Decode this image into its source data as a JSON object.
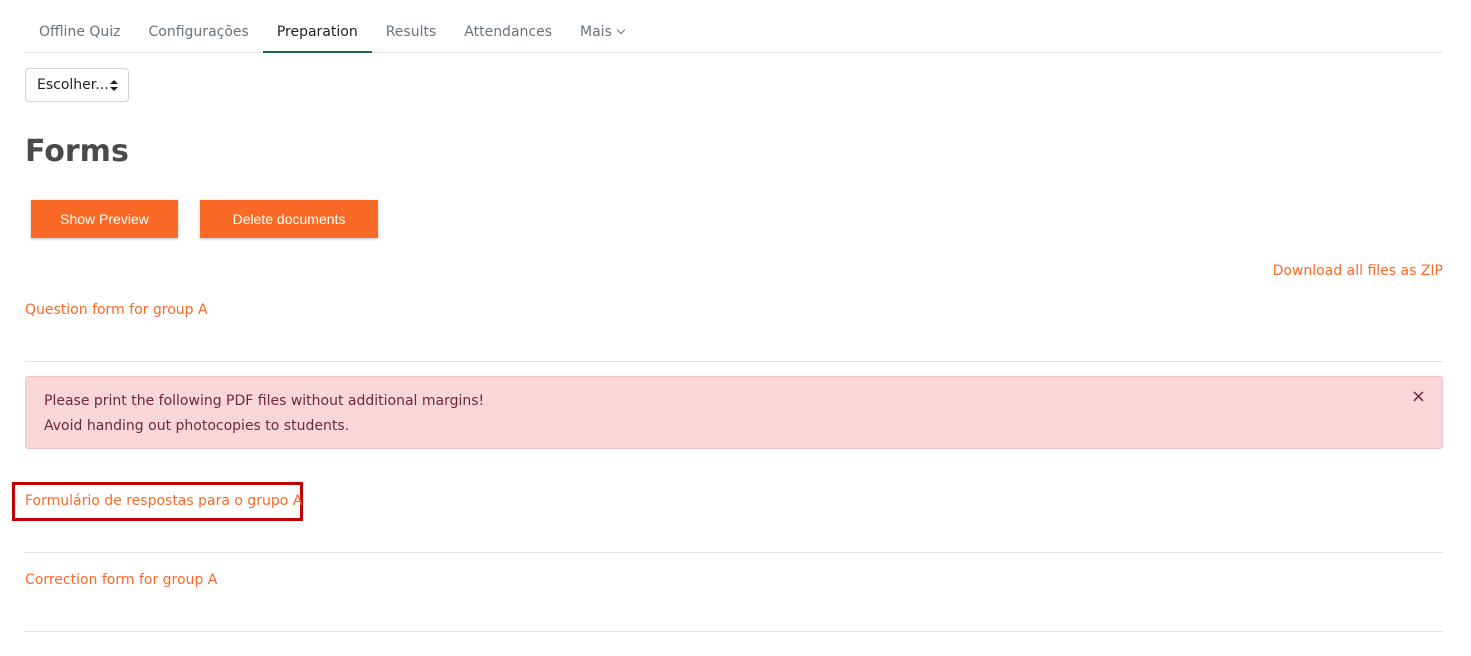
{
  "tabs": [
    {
      "label": "Offline Quiz",
      "active": false
    },
    {
      "label": "Configurações",
      "active": false
    },
    {
      "label": "Preparation",
      "active": true
    },
    {
      "label": "Results",
      "active": false
    },
    {
      "label": "Attendances",
      "active": false
    },
    {
      "label": "Mais",
      "active": false
    }
  ],
  "select": {
    "value": "Escolher..."
  },
  "page": {
    "title": "Forms"
  },
  "buttons": {
    "preview": "Show Preview",
    "delete": "Delete documents"
  },
  "links": {
    "download_zip": "Download all files as ZIP",
    "question_form": "Question form for group A",
    "answer_form": "Formulário de respostas para o grupo A",
    "correction_form": "Correction form for group A"
  },
  "alert": {
    "line1": "Please print the following PDF files without additional margins!",
    "line2": "Avoid handing out photocopies to students.",
    "close": "×"
  },
  "colors": {
    "accent": "#f96a26",
    "active_tab": "#1f6e43",
    "alert_bg": "#f9d6da",
    "highlight": "#c00000"
  }
}
